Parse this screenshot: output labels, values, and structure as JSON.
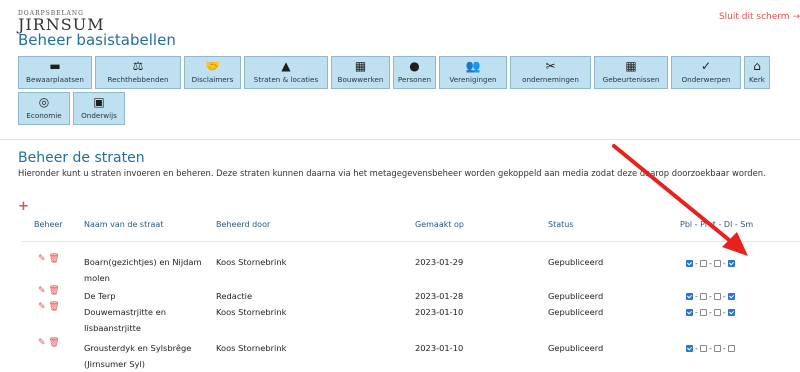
{
  "brand": {
    "small": "DOARPSBELANG",
    "name": "JIRNSUM"
  },
  "close_link": "Sluit dit scherm",
  "page_title": "Beheer basistabellen",
  "nav_row1": [
    {
      "label": "Bewaarplaatsen",
      "icon": "▬"
    },
    {
      "label": "Rechthebbenden",
      "icon": "⚖"
    },
    {
      "label": "Disclaimers",
      "icon": "🤝"
    },
    {
      "label": "Straten & locaties",
      "icon": "▲"
    },
    {
      "label": "Bouwwerken",
      "icon": "▦"
    },
    {
      "label": "Personen",
      "icon": "●"
    },
    {
      "label": "Verenigingen",
      "icon": "👥"
    },
    {
      "label": "ondernemingen",
      "icon": "✂"
    },
    {
      "label": "Gebeurtenissen",
      "icon": "▦"
    },
    {
      "label": "Onderwerpen",
      "icon": "✓"
    },
    {
      "label": "Kerk",
      "icon": "⌂"
    }
  ],
  "nav_row2": [
    {
      "label": "Economie",
      "icon": "◎"
    },
    {
      "label": "Onderwijs",
      "icon": "▣"
    }
  ],
  "section_title": "Beheer de straten",
  "intro": "Hieronder kunt u straten invoeren en beheren. Deze straten kunnen daarna via het metagegevensbeheer worden gekoppeld aan media zodat deze daarop doorzoekbaar worden.",
  "add_symbol": "+",
  "table": {
    "headers": {
      "beheer": "Beheer",
      "naam": "Naam van de straat",
      "door": "Beheerd door",
      "gemaakt": "Gemaakt op",
      "status": "Status",
      "flags": "Pbl - Prvt - Dl - Sm"
    },
    "rows": [
      {
        "naam_1": "Boarn(gezichtjes) en Nijdam",
        "naam_2": "molen",
        "door": "Koos Stornebrink",
        "gemaakt": "2023-01-29",
        "status": "Gepubliceerd",
        "flags": [
          true,
          false,
          false,
          true
        ]
      },
      {
        "naam_1": "De Terp",
        "naam_2": "",
        "door": "Redactie",
        "gemaakt": "2023-01-28",
        "status": "Gepubliceerd",
        "flags": [
          true,
          false,
          false,
          true
        ]
      },
      {
        "naam_1": "Douwemastrjitte en",
        "naam_2": "Iisbaanstrjitte",
        "door": "Koos Stornebrink",
        "gemaakt": "2023-01-10",
        "status": "Gepubliceerd",
        "flags": [
          true,
          false,
          false,
          true
        ]
      },
      {
        "naam_1": "Grousterdyk en Sylsbrêge",
        "naam_2": "(Jirnsumer Syl)",
        "door": "Koos Stornebrink",
        "gemaakt": "2023-01-10",
        "status": "Gepubliceerd",
        "flags": [
          true,
          false,
          false,
          false
        ]
      }
    ]
  },
  "colors": {
    "accent": "#1f6f9f",
    "button_bg": "#bfe0f0",
    "danger": "#d9534f",
    "arrow": "#e8201e"
  }
}
